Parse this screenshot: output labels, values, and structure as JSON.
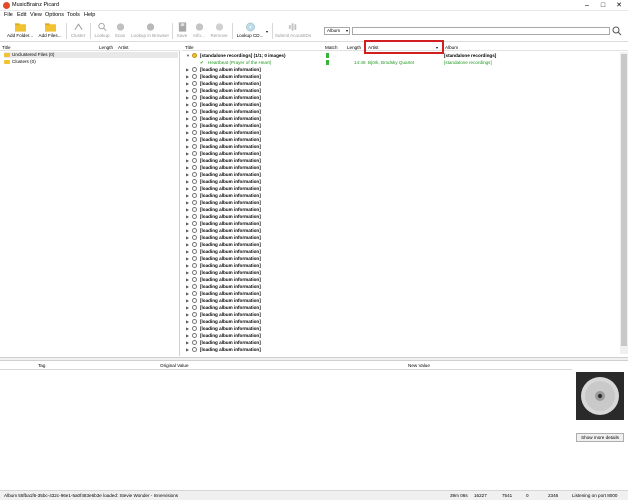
{
  "window": {
    "title": "MusicBrainz Picard"
  },
  "menu": [
    "File",
    "Edit",
    "View",
    "Options",
    "Tools",
    "Help"
  ],
  "toolbar": {
    "buttons": [
      {
        "label": "Add Folder...",
        "enabled": true
      },
      {
        "label": "Add Files...",
        "enabled": true
      },
      {
        "label": "Cluster",
        "enabled": false
      },
      {
        "label": "Lookup",
        "enabled": false
      },
      {
        "label": "Scan",
        "enabled": false
      },
      {
        "label": "Lookup in Browser",
        "enabled": false
      },
      {
        "label": "Save",
        "enabled": false
      },
      {
        "label": "Info...",
        "enabled": false
      },
      {
        "label": "Remove",
        "enabled": false
      },
      {
        "label": "Lookup CD...",
        "enabled": true
      },
      {
        "label": "Submit AcoustIDs",
        "enabled": false
      }
    ],
    "search_type": "Album",
    "search_value": ""
  },
  "left_pane": {
    "columns": [
      "Title",
      "Length",
      "Artist"
    ],
    "items": [
      {
        "label": "Unclustered Files (0)"
      },
      {
        "label": "Clusters (0)"
      }
    ]
  },
  "right_pane": {
    "columns": [
      "Title",
      "Match",
      "Length",
      "Artist",
      "Album"
    ],
    "album": {
      "title": "[standalone recordings] (1/1; 0 images)",
      "album": "[standalone recordings]"
    },
    "track": {
      "title": "Heartbeat (Prayer of the Heart)",
      "length": "14:46",
      "artist": "Björk, Brodsky Quartet",
      "album": "[standalone recordings]"
    },
    "loading_label": "[loading album information]"
  },
  "metadata": {
    "columns": [
      "Tag",
      "Original Value",
      "New Value"
    ]
  },
  "cover": {
    "button_label": "Show more details"
  },
  "statusbar": {
    "message": "Album 55fba1f6-35bc-432c-96e1-5a0f483e6b3e loaded: Stevie Wonder - Innervisions",
    "count1": "39m 06s",
    "count2": "16227",
    "count3": "7541",
    "count4": "0",
    "count5": "2346",
    "listening": "Listening on port 8000"
  },
  "colors": {
    "accent": "#d21f1f",
    "green": "#1f9b1f"
  }
}
